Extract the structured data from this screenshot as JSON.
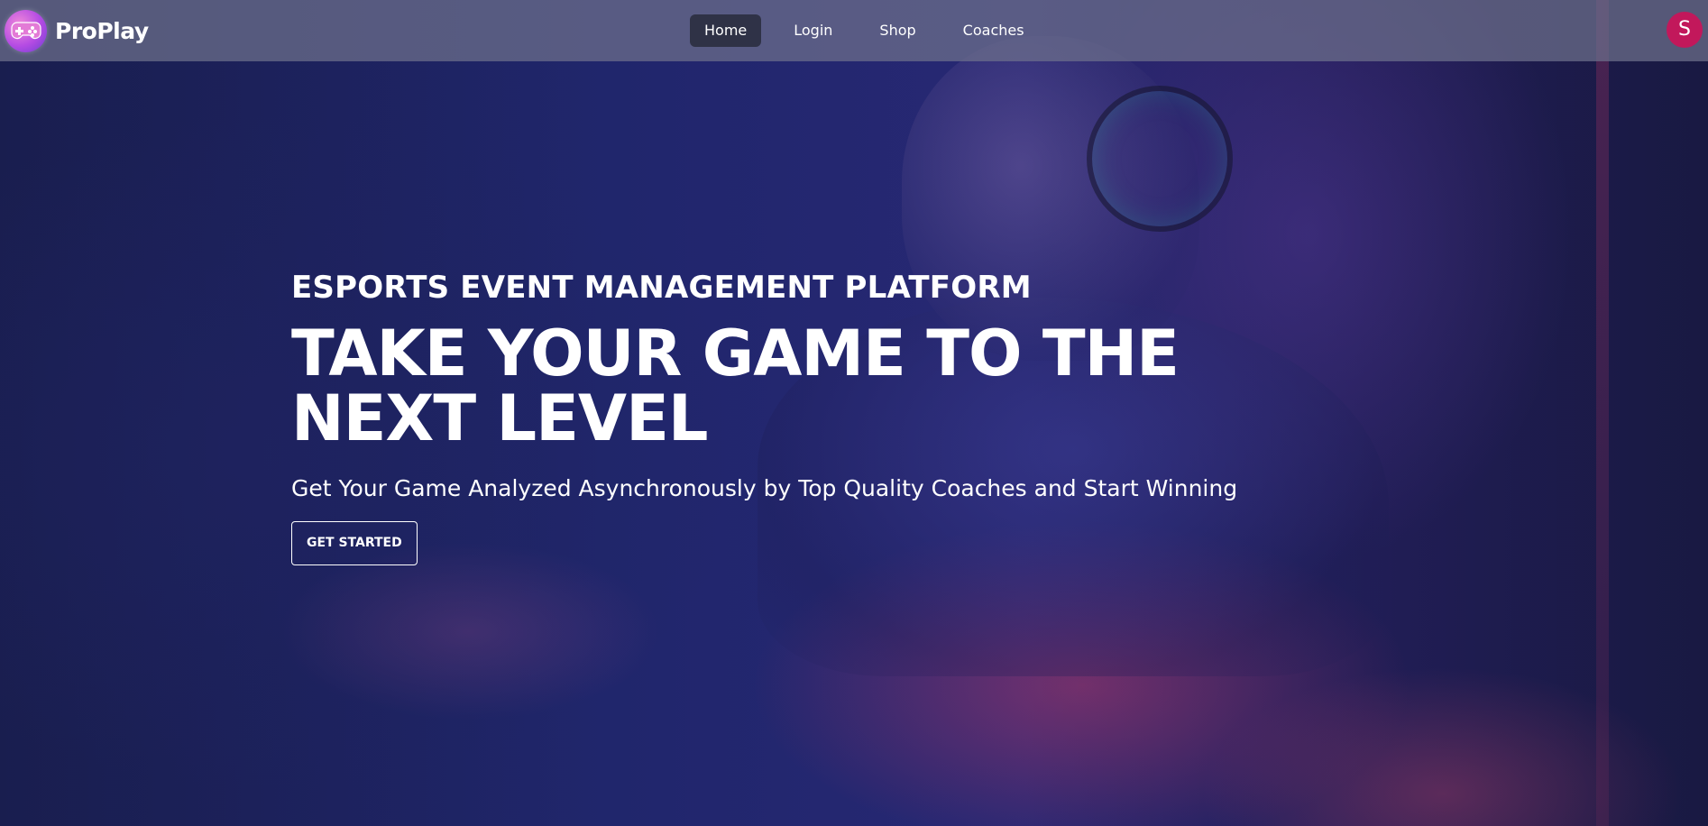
{
  "brand": {
    "name": "ProPlay",
    "logo_icon": "gamepad-icon",
    "logo_colors": [
      "#f18ad9",
      "#b44be3",
      "#6a3fd0"
    ]
  },
  "nav": {
    "items": [
      {
        "label": "Home",
        "active": true
      },
      {
        "label": "Login",
        "active": false
      },
      {
        "label": "Shop",
        "active": false
      },
      {
        "label": "Coaches",
        "active": false
      }
    ]
  },
  "user": {
    "avatar_initial": "S",
    "avatar_color": "#c2185b"
  },
  "hero": {
    "eyebrow": "ESPORTS EVENT MANAGEMENT PLATFORM",
    "headline": "TAKE YOUR GAME TO THE NEXT LEVEL",
    "subheadline": "Get Your Game Analyzed Asynchronously by Top Quality Coaches and Start Winning",
    "cta_label": "GET STARTED",
    "background_image": "gamer-wearing-headset-photo"
  }
}
